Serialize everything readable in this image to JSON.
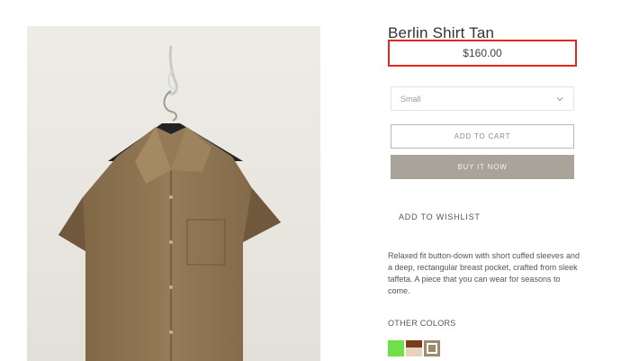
{
  "product": {
    "title": "Berlin Shirt Tan",
    "price": "$160.00",
    "size_selected": "Small",
    "add_to_cart_label": "ADD TO CART",
    "buy_now_label": "BUY IT NOW",
    "wishlist_label": "ADD TO WISHLIST",
    "description": "Relaxed fit button-down with short cuffed sleeves and a deep, rectangular breast pocket, crafted from sleek taffeta. A piece that you can wear for seasons to come.",
    "other_colors_label": "OTHER COLORS",
    "swatches": [
      {
        "name": "green",
        "color": "#6fe04a"
      },
      {
        "name": "brown-cream",
        "color": "#7a3b1f",
        "color2": "#e8d3b6"
      },
      {
        "name": "tan",
        "color": "#9b8a6b"
      }
    ]
  },
  "colors": {
    "price_highlight": "#e02a1f",
    "buy_now_bg": "#a9a39a",
    "shirt": "#8a7150"
  },
  "icons": {
    "size_dropdown": "chevron-down-icon"
  }
}
